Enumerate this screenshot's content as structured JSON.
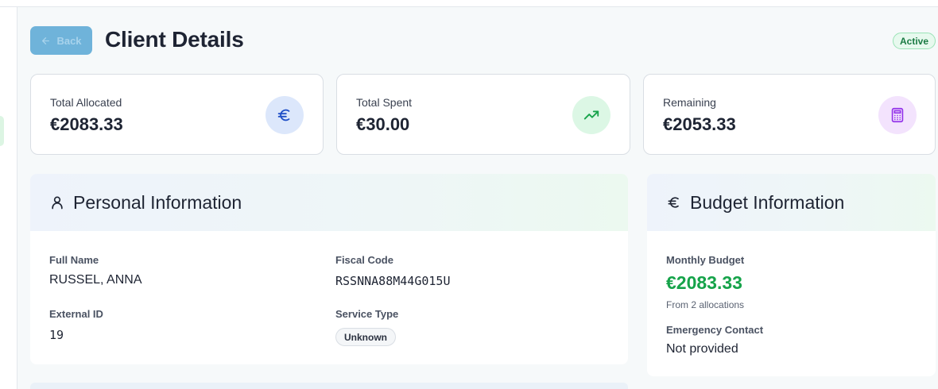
{
  "header": {
    "back_label": "Back",
    "title": "Client Details",
    "status": "Active"
  },
  "stats": [
    {
      "label": "Total Allocated",
      "value": "€2083.33",
      "icon": "euro-icon",
      "icon_color": "#1f4fc7",
      "icon_bg": "#dce7fb"
    },
    {
      "label": "Total Spent",
      "value": "€30.00",
      "icon": "trending-up-icon",
      "icon_color": "#16a34a",
      "icon_bg": "#dcf7e5"
    },
    {
      "label": "Remaining",
      "value": "€2053.33",
      "icon": "calculator-icon",
      "icon_color": "#9333ea",
      "icon_bg": "#f3e3fd"
    }
  ],
  "personal": {
    "title": "Personal Information",
    "full_name_label": "Full Name",
    "full_name": "RUSSEL, ANNA",
    "fiscal_code_label": "Fiscal Code",
    "fiscal_code": "RSSNNA88M44G015U",
    "external_id_label": "External ID",
    "external_id": "19",
    "service_type_label": "Service Type",
    "service_type": "Unknown"
  },
  "budget": {
    "title": "Budget Information",
    "monthly_label": "Monthly Budget",
    "monthly_value": "€2083.33",
    "monthly_note": "From 2 allocations",
    "emergency_label": "Emergency Contact",
    "emergency_value": "Not provided",
    "accent": "#16a34a"
  }
}
